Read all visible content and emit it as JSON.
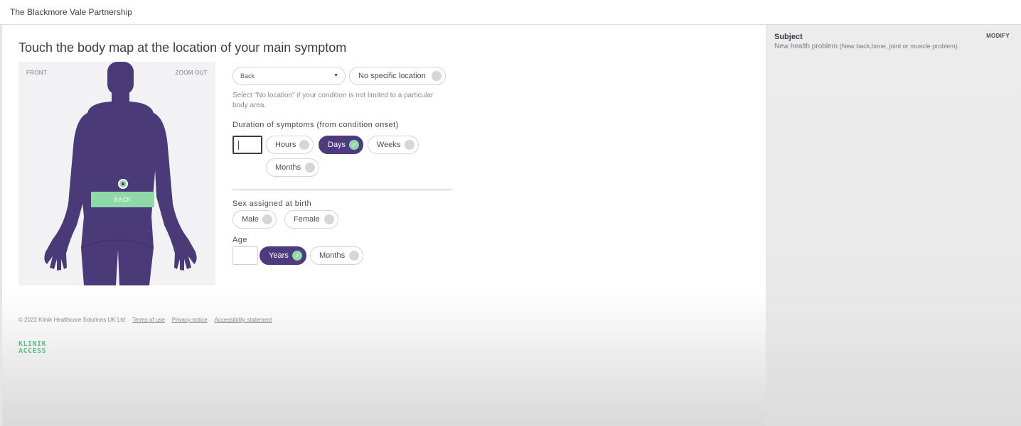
{
  "header": {
    "org_name": "The Blackmore Vale Partnership"
  },
  "main": {
    "title": "Touch the body map at the location of your main symptom",
    "bodymap": {
      "front_label": "FRONT",
      "zoom_out_label": "ZOOM OUT",
      "selected_area_label": "BACK"
    },
    "location": {
      "select_value": "Back",
      "no_location_label": "No specific location",
      "helper_text": "Select \"No location\" if your condition is not limited to a particular body area."
    },
    "duration": {
      "label": "Duration of symptoms (from condition onset)",
      "value": "",
      "units": [
        {
          "label": "Hours",
          "selected": false
        },
        {
          "label": "Days",
          "selected": true
        },
        {
          "label": "Weeks",
          "selected": false
        },
        {
          "label": "Months",
          "selected": false
        }
      ]
    },
    "sex": {
      "label": "Sex assigned at birth",
      "options": [
        {
          "label": "Male",
          "selected": false
        },
        {
          "label": "Female",
          "selected": false
        }
      ]
    },
    "age": {
      "label": "Age",
      "value": "",
      "units": [
        {
          "label": "Years",
          "selected": true
        },
        {
          "label": "Months",
          "selected": false
        }
      ]
    }
  },
  "footer": {
    "copyright": "© 2022 Klinik Healthcare Solutions UK Ltd",
    "links": [
      "Terms of use",
      "Privacy notice",
      "Accessibility statement"
    ],
    "logo_line1": "KLINIK",
    "logo_line2": "ACCESS"
  },
  "sidebar": {
    "subject_label": "Subject",
    "modify_label": "MODIFY",
    "subject_value": "New health problem",
    "subject_detail": "(New back,bone, joint or muscle problem)"
  },
  "colors": {
    "accent_purple": "#4d3a7f",
    "accent_green": "#8fd9a8",
    "body_silhouette": "#4b3a78"
  },
  "icons": {
    "select_caret": "chevron-down-icon",
    "selected_radio": "check-icon"
  }
}
